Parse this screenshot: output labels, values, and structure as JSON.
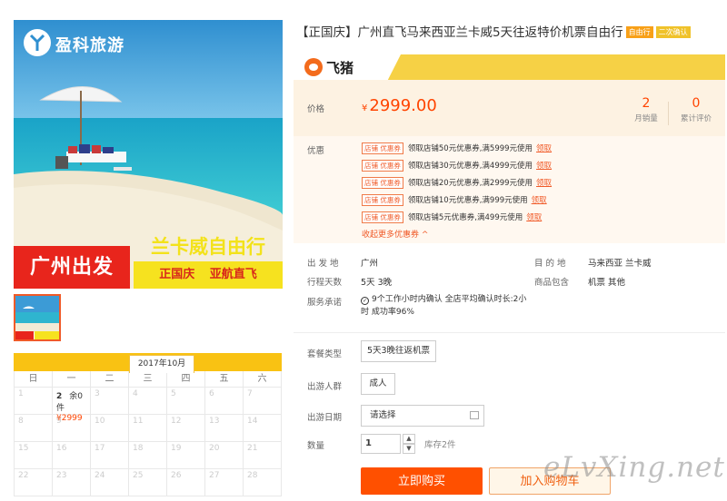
{
  "hero": {
    "brand": "盈科旅游",
    "tag_left": "广州出发",
    "tag_right_top": "兰卡威自由行",
    "tag_right_bottom": "正国庆 亚航直飞"
  },
  "calendar": {
    "month": "2017年10月",
    "weekdays": [
      "日",
      "一",
      "二",
      "三",
      "四",
      "五",
      "六"
    ],
    "days": [
      {
        "d": "1"
      },
      {
        "d": "2",
        "stock": "余0件",
        "price": "¥2999",
        "active": true
      },
      {
        "d": "3"
      },
      {
        "d": "4"
      },
      {
        "d": "5"
      },
      {
        "d": "6"
      },
      {
        "d": "7"
      },
      {
        "d": "8"
      },
      {
        "d": "9"
      },
      {
        "d": "10"
      },
      {
        "d": "11"
      },
      {
        "d": "12"
      },
      {
        "d": "13"
      },
      {
        "d": "14"
      },
      {
        "d": "15"
      },
      {
        "d": "16"
      },
      {
        "d": "17"
      },
      {
        "d": "18"
      },
      {
        "d": "19"
      },
      {
        "d": "20"
      },
      {
        "d": "21"
      },
      {
        "d": "22"
      },
      {
        "d": "23"
      },
      {
        "d": "24"
      },
      {
        "d": "25"
      },
      {
        "d": "26"
      },
      {
        "d": "27"
      },
      {
        "d": "28"
      }
    ]
  },
  "product": {
    "title": "【正国庆】广州直飞马来西亚兰卡威5天往返特价机票自由行",
    "badge_free": "自由行",
    "badge_confirm": "二次确认",
    "platform": "飞猪"
  },
  "price": {
    "label": "价格",
    "symbol": "¥",
    "value": "2999.00",
    "monthly_sales": "2",
    "monthly_sales_label": "月销量",
    "reviews": "0",
    "reviews_label": "累计评价"
  },
  "coupons": {
    "label": "优惠",
    "tag": "店铺 优惠券",
    "get_label": "领取",
    "items": [
      "领取店铺50元优惠券,满5999元使用",
      "领取店铺30元优惠券,满4999元使用",
      "领取店铺20元优惠券,满2999元使用",
      "领取店铺10元优惠券,满999元使用",
      "领取店铺5元优惠券,满499元使用"
    ],
    "collapse_label": "收起更多优惠券 ^"
  },
  "details": {
    "origin_label": "出 发 地",
    "origin": "广州",
    "destination_label": "目 的 地",
    "destination": "马来西亚 兰卡威",
    "days_label": "行程天数",
    "days": "5天 3晚",
    "includes_label": "商品包含",
    "includes": "机票 其他",
    "service_label": "服务承诺",
    "service": "9个工作小时内确认 全店平均确认时长:2小时 成功率96%"
  },
  "options": {
    "package_label": "套餐类型",
    "package_value": "5天3晚往返机票",
    "crowd_label": "出游人群",
    "crowd_value": "成人",
    "date_label": "出游日期",
    "date_value": "请选择",
    "qty_label": "数量",
    "qty_value": "1",
    "stock_note": "库存2件",
    "buy_label": "立即购买",
    "cart_label": "加入购物车"
  },
  "watermark": "eLvXing.net",
  "colors": {
    "accent": "#ff5000",
    "price": "#ff4400",
    "brand_bar": "#f6d145",
    "calendar_header": "#f9c213"
  }
}
